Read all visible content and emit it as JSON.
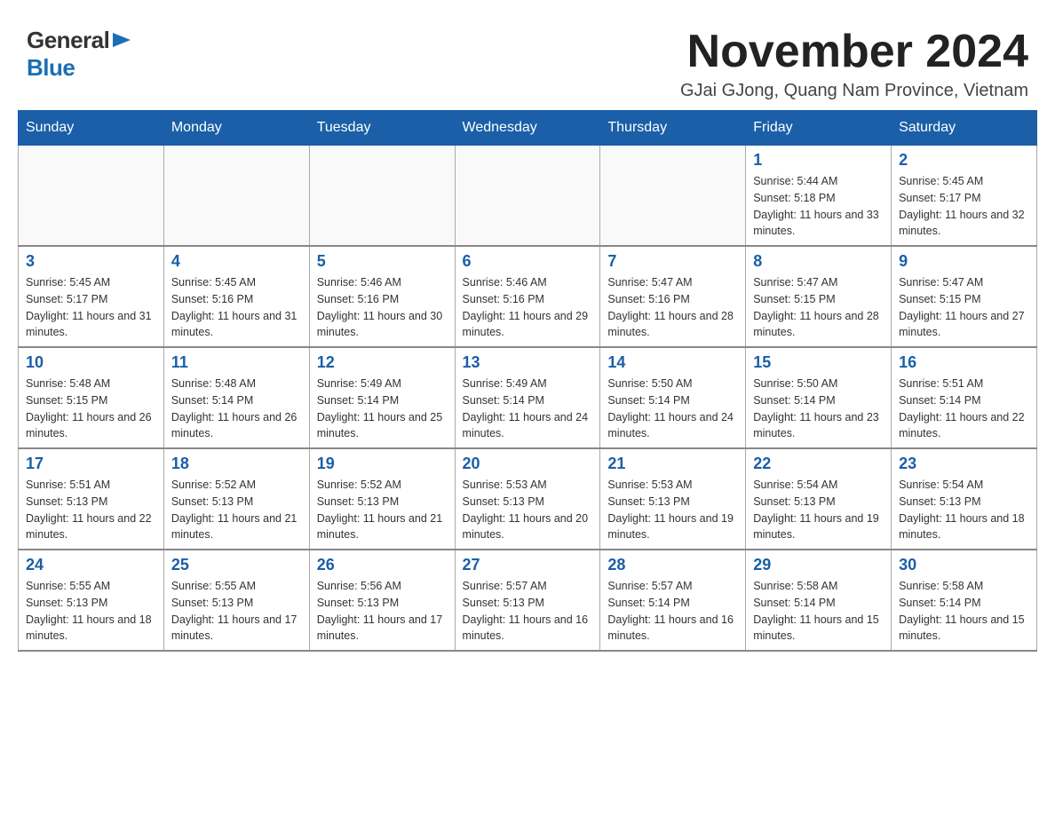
{
  "logo": {
    "general": "General",
    "blue": "Blue"
  },
  "title": "November 2024",
  "location": "GJai GJong, Quang Nam Province, Vietnam",
  "days_of_week": [
    "Sunday",
    "Monday",
    "Tuesday",
    "Wednesday",
    "Thursday",
    "Friday",
    "Saturday"
  ],
  "weeks": [
    [
      {
        "day": "",
        "info": ""
      },
      {
        "day": "",
        "info": ""
      },
      {
        "day": "",
        "info": ""
      },
      {
        "day": "",
        "info": ""
      },
      {
        "day": "",
        "info": ""
      },
      {
        "day": "1",
        "info": "Sunrise: 5:44 AM\nSunset: 5:18 PM\nDaylight: 11 hours and 33 minutes."
      },
      {
        "day": "2",
        "info": "Sunrise: 5:45 AM\nSunset: 5:17 PM\nDaylight: 11 hours and 32 minutes."
      }
    ],
    [
      {
        "day": "3",
        "info": "Sunrise: 5:45 AM\nSunset: 5:17 PM\nDaylight: 11 hours and 31 minutes."
      },
      {
        "day": "4",
        "info": "Sunrise: 5:45 AM\nSunset: 5:16 PM\nDaylight: 11 hours and 31 minutes."
      },
      {
        "day": "5",
        "info": "Sunrise: 5:46 AM\nSunset: 5:16 PM\nDaylight: 11 hours and 30 minutes."
      },
      {
        "day": "6",
        "info": "Sunrise: 5:46 AM\nSunset: 5:16 PM\nDaylight: 11 hours and 29 minutes."
      },
      {
        "day": "7",
        "info": "Sunrise: 5:47 AM\nSunset: 5:16 PM\nDaylight: 11 hours and 28 minutes."
      },
      {
        "day": "8",
        "info": "Sunrise: 5:47 AM\nSunset: 5:15 PM\nDaylight: 11 hours and 28 minutes."
      },
      {
        "day": "9",
        "info": "Sunrise: 5:47 AM\nSunset: 5:15 PM\nDaylight: 11 hours and 27 minutes."
      }
    ],
    [
      {
        "day": "10",
        "info": "Sunrise: 5:48 AM\nSunset: 5:15 PM\nDaylight: 11 hours and 26 minutes."
      },
      {
        "day": "11",
        "info": "Sunrise: 5:48 AM\nSunset: 5:14 PM\nDaylight: 11 hours and 26 minutes."
      },
      {
        "day": "12",
        "info": "Sunrise: 5:49 AM\nSunset: 5:14 PM\nDaylight: 11 hours and 25 minutes."
      },
      {
        "day": "13",
        "info": "Sunrise: 5:49 AM\nSunset: 5:14 PM\nDaylight: 11 hours and 24 minutes."
      },
      {
        "day": "14",
        "info": "Sunrise: 5:50 AM\nSunset: 5:14 PM\nDaylight: 11 hours and 24 minutes."
      },
      {
        "day": "15",
        "info": "Sunrise: 5:50 AM\nSunset: 5:14 PM\nDaylight: 11 hours and 23 minutes."
      },
      {
        "day": "16",
        "info": "Sunrise: 5:51 AM\nSunset: 5:14 PM\nDaylight: 11 hours and 22 minutes."
      }
    ],
    [
      {
        "day": "17",
        "info": "Sunrise: 5:51 AM\nSunset: 5:13 PM\nDaylight: 11 hours and 22 minutes."
      },
      {
        "day": "18",
        "info": "Sunrise: 5:52 AM\nSunset: 5:13 PM\nDaylight: 11 hours and 21 minutes."
      },
      {
        "day": "19",
        "info": "Sunrise: 5:52 AM\nSunset: 5:13 PM\nDaylight: 11 hours and 21 minutes."
      },
      {
        "day": "20",
        "info": "Sunrise: 5:53 AM\nSunset: 5:13 PM\nDaylight: 11 hours and 20 minutes."
      },
      {
        "day": "21",
        "info": "Sunrise: 5:53 AM\nSunset: 5:13 PM\nDaylight: 11 hours and 19 minutes."
      },
      {
        "day": "22",
        "info": "Sunrise: 5:54 AM\nSunset: 5:13 PM\nDaylight: 11 hours and 19 minutes."
      },
      {
        "day": "23",
        "info": "Sunrise: 5:54 AM\nSunset: 5:13 PM\nDaylight: 11 hours and 18 minutes."
      }
    ],
    [
      {
        "day": "24",
        "info": "Sunrise: 5:55 AM\nSunset: 5:13 PM\nDaylight: 11 hours and 18 minutes."
      },
      {
        "day": "25",
        "info": "Sunrise: 5:55 AM\nSunset: 5:13 PM\nDaylight: 11 hours and 17 minutes."
      },
      {
        "day": "26",
        "info": "Sunrise: 5:56 AM\nSunset: 5:13 PM\nDaylight: 11 hours and 17 minutes."
      },
      {
        "day": "27",
        "info": "Sunrise: 5:57 AM\nSunset: 5:13 PM\nDaylight: 11 hours and 16 minutes."
      },
      {
        "day": "28",
        "info": "Sunrise: 5:57 AM\nSunset: 5:14 PM\nDaylight: 11 hours and 16 minutes."
      },
      {
        "day": "29",
        "info": "Sunrise: 5:58 AM\nSunset: 5:14 PM\nDaylight: 11 hours and 15 minutes."
      },
      {
        "day": "30",
        "info": "Sunrise: 5:58 AM\nSunset: 5:14 PM\nDaylight: 11 hours and 15 minutes."
      }
    ]
  ]
}
